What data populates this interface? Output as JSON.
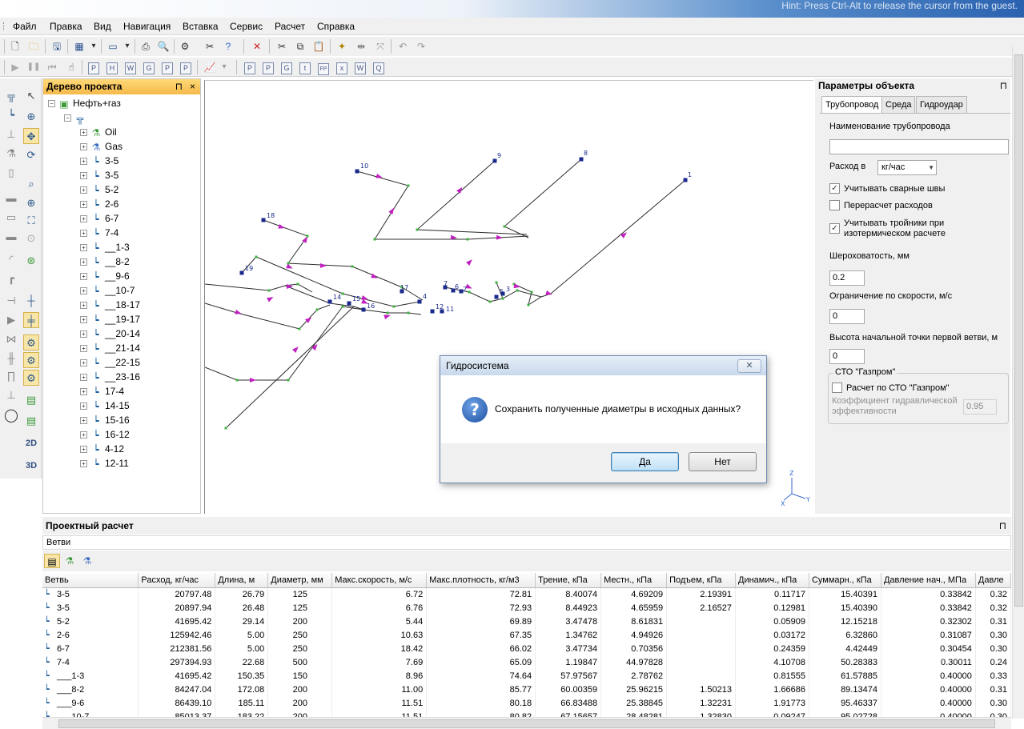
{
  "window": {
    "hint": "Hint: Press Ctrl-Alt to release the cursor from the guest."
  },
  "menu": [
    "Файл",
    "Правка",
    "Вид",
    "Навигация",
    "Вставка",
    "Сервис",
    "Расчет",
    "Справка"
  ],
  "toolbar2_letters": [
    "P",
    "H",
    "W",
    "G",
    "P",
    "P",
    "P",
    "P",
    "G",
    "t",
    "FP",
    "x",
    "W",
    "Q"
  ],
  "tree": {
    "title": "Дерево проекта",
    "pin": "⊓",
    "close": "×",
    "root": "Нефть+газ",
    "nodes": [
      {
        "label": "Oil",
        "kind": "oil"
      },
      {
        "label": "Gas",
        "kind": "gas"
      },
      {
        "label": "3-5",
        "kind": "branch"
      },
      {
        "label": "3-5",
        "kind": "branch"
      },
      {
        "label": "5-2",
        "kind": "branch"
      },
      {
        "label": "2-6",
        "kind": "branch"
      },
      {
        "label": "6-7",
        "kind": "branch"
      },
      {
        "label": "7-4",
        "kind": "branch"
      },
      {
        "label": "__1-3",
        "kind": "branch"
      },
      {
        "label": "__8-2",
        "kind": "branch"
      },
      {
        "label": "__9-6",
        "kind": "branch"
      },
      {
        "label": "__10-7",
        "kind": "branch"
      },
      {
        "label": "__18-17",
        "kind": "branch"
      },
      {
        "label": "__19-17",
        "kind": "branch"
      },
      {
        "label": "__20-14",
        "kind": "branch"
      },
      {
        "label": "__21-14",
        "kind": "branch"
      },
      {
        "label": "__22-15",
        "kind": "branch"
      },
      {
        "label": "__23-16",
        "kind": "branch"
      },
      {
        "label": "17-4",
        "kind": "branch"
      },
      {
        "label": "14-15",
        "kind": "branch"
      },
      {
        "label": "15-16",
        "kind": "branch"
      },
      {
        "label": "16-12",
        "kind": "branch"
      },
      {
        "label": "4-12",
        "kind": "branch"
      },
      {
        "label": "12-11",
        "kind": "branch"
      }
    ]
  },
  "left_tools": {
    "btn_2d": "2D",
    "btn_3d": "3D"
  },
  "canvas": {
    "node_labels": [
      "10",
      "9",
      "8",
      "1",
      "18",
      "19",
      "17",
      "7",
      "6",
      "2",
      "5",
      "3",
      "4",
      "14",
      "15",
      "16",
      "12",
      "11"
    ],
    "axis_labels": {
      "z": "Z",
      "x": "X",
      "y": "Y"
    }
  },
  "props": {
    "title": "Параметры объекта",
    "pin": "⊓",
    "tabs": [
      "Трубопровод",
      "Среда",
      "Гидроудар"
    ],
    "name_label": "Наименование трубопровода",
    "name_value": "",
    "flow_label": "Расход в",
    "flow_unit": "кг/час",
    "chk_welds": "Учитывать сварные швы",
    "chk_welds_checked": true,
    "chk_recalc": "Перерасчет расходов",
    "chk_recalc_checked": false,
    "chk_tees": "Учитывать тройники при изотермическом расчете",
    "chk_tees_checked": true,
    "rough_label": "Шероховатость, мм",
    "rough_value": "0.2",
    "speed_label": "Ограничение по скорости, м/с",
    "speed_value": "0",
    "height_label": "Высота начальной точки первой ветви, м",
    "height_value": "0",
    "group_label": "СТО \"Газпром\"",
    "chk_gazprom": "Расчет по СТО \"Газпром\"",
    "chk_gazprom_checked": false,
    "coef_label": "Коэффициент гидравлической эффективности",
    "coef_value": "0.95"
  },
  "bottom": {
    "title": "Проектный расчет",
    "pin": "⊓",
    "subtab": "Ветви",
    "columns": [
      "Ветвь",
      "Расход, кг/час",
      "Длина, м",
      "Диаметр, мм",
      "Макс.скорость, м/с",
      "Макс.плотность, кг/м3",
      "Трение, кПа",
      "Местн., кПа",
      "Подъем, кПа",
      "Динамич., кПа",
      "Суммарн., кПа",
      "Давление нач., МПа",
      "Давле"
    ],
    "rows": [
      [
        "3-5",
        "20797.48",
        "26.79",
        "125",
        "6.72",
        "72.81",
        "8.40074",
        "4.69209",
        "2.19391",
        "0.11717",
        "15.40391",
        "0.33842",
        "0.32"
      ],
      [
        "3-5",
        "20897.94",
        "26.48",
        "125",
        "6.76",
        "72.93",
        "8.44923",
        "4.65959",
        "2.16527",
        "0.12981",
        "15.40390",
        "0.33842",
        "0.32"
      ],
      [
        "5-2",
        "41695.42",
        "29.14",
        "200",
        "5.44",
        "69.89",
        "3.47478",
        "8.61831",
        "",
        "0.05909",
        "12.15218",
        "0.32302",
        "0.31"
      ],
      [
        "2-6",
        "125942.46",
        "5.00",
        "250",
        "10.63",
        "67.35",
        "1.34762",
        "4.94926",
        "",
        "0.03172",
        "6.32860",
        "0.31087",
        "0.30"
      ],
      [
        "6-7",
        "212381.56",
        "5.00",
        "250",
        "18.42",
        "66.02",
        "3.47734",
        "0.70356",
        "",
        "0.24359",
        "4.42449",
        "0.30454",
        "0.30"
      ],
      [
        "7-4",
        "297394.93",
        "22.68",
        "500",
        "7.69",
        "65.09",
        "1.19847",
        "44.97828",
        "",
        "4.10708",
        "50.28383",
        "0.30011",
        "0.24"
      ],
      [
        "___1-3",
        "41695.42",
        "150.35",
        "150",
        "8.96",
        "74.64",
        "57.97567",
        "2.78762",
        "",
        "0.81555",
        "61.57885",
        "0.40000",
        "0.33"
      ],
      [
        "___8-2",
        "84247.04",
        "172.08",
        "200",
        "11.00",
        "85.77",
        "60.00359",
        "25.96215",
        "1.50213",
        "1.66686",
        "89.13474",
        "0.40000",
        "0.31"
      ],
      [
        "___9-6",
        "86439.10",
        "185.11",
        "200",
        "11.51",
        "80.18",
        "66.83488",
        "25.38845",
        "1.32231",
        "1.91773",
        "95.46337",
        "0.40000",
        "0.30"
      ],
      [
        "___10-7",
        "85013.37",
        "183.22",
        "200",
        "11.51",
        "80.82",
        "67.15657",
        "28.48281",
        "1.32830",
        "0.09247",
        "95.02728",
        "0.40000",
        "0.30"
      ]
    ]
  },
  "dialog": {
    "title": "Гидросистема",
    "close": "✕",
    "message": "Сохранить полученные диаметры в исходных данных?",
    "yes": "Да",
    "no": "Нет"
  }
}
